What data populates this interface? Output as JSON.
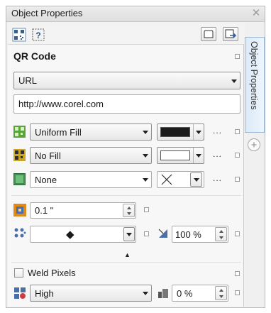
{
  "window": {
    "title": "Object Properties",
    "close_glyph": "✕"
  },
  "side_tab": {
    "label": "Object Properties",
    "add_glyph": "+"
  },
  "section": {
    "heading": "QR Code"
  },
  "qr_type": {
    "selected": "URL"
  },
  "url_field": {
    "value": "http://www.corel.com"
  },
  "fills": [
    {
      "label": "Uniform Fill",
      "swatch": "#1c1c1c",
      "icon": "qr-uniform-fill-icon",
      "icon_color": "#5aa33a"
    },
    {
      "label": "No Fill",
      "swatch": "#ffffff",
      "icon": "qr-pattern-fill-icon",
      "icon_color": "#c9a623"
    },
    {
      "label": "None",
      "swatch": "none",
      "icon": "background-fill-icon",
      "icon_color": "#3f8f4e"
    }
  ],
  "more_dots": "...",
  "outline": {
    "width": "0.1 \""
  },
  "pixel_shape": {
    "symbol": "◆"
  },
  "roundness": {
    "value": "100 %"
  },
  "weld": {
    "label": "Weld Pixels",
    "checked": false
  },
  "error_correction": {
    "selected": "High"
  },
  "border": {
    "value": "0 %"
  },
  "collapse_glyph": "▲",
  "colors": {
    "accent": "#9cb9d8",
    "panel": "#f2f2f2"
  }
}
